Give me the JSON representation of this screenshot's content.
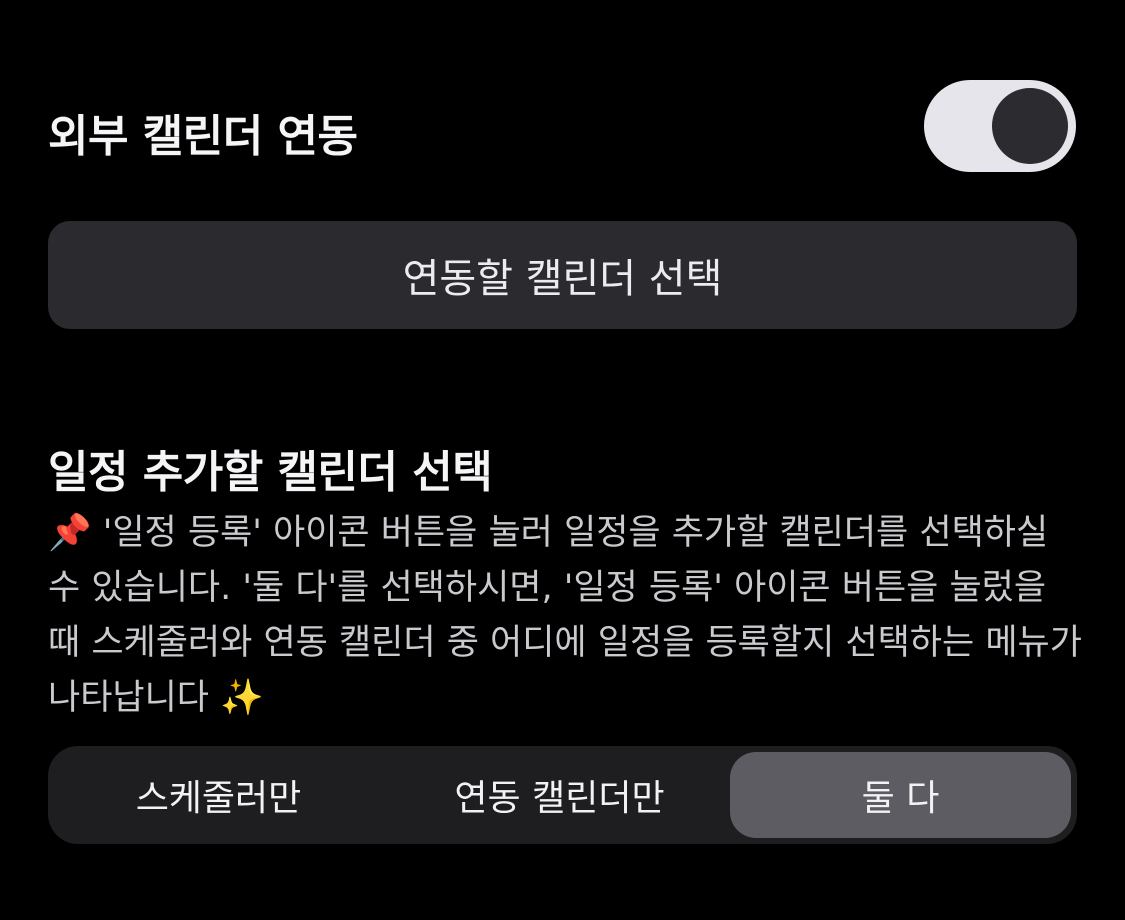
{
  "sync": {
    "title": "외부 캘린더 연동",
    "toggle_on": true
  },
  "select_calendar_button": "연동할 캘린더 선택",
  "add_calendar_section": {
    "title": "일정 추가할 캘린더 선택",
    "description_icon": "📌",
    "description": "'일정 등록' 아이콘 버튼을 눌러 일정을 추가할 캘린더를 선택하실 수 있습니다. '둘 다'를 선택하시면, '일정 등록' 아이콘 버튼을 눌렀을 때 스케줄러와 연동 캘린더 중 어디에 일정을 등록할지 선택하는 메뉴가 나타납니다",
    "description_trailing_icon": "✨"
  },
  "segments": [
    {
      "label": "스케줄러만",
      "selected": false
    },
    {
      "label": "연동 캘린더만",
      "selected": false
    },
    {
      "label": "둘 다",
      "selected": true
    }
  ],
  "colors": {
    "background": "#000000",
    "toggle_track": "#e6e5ec",
    "toggle_knob": "#2c2c30",
    "button_bg": "#2b2b2f",
    "segment_bg": "#1e1e21",
    "segment_active": "#5c5c62"
  }
}
